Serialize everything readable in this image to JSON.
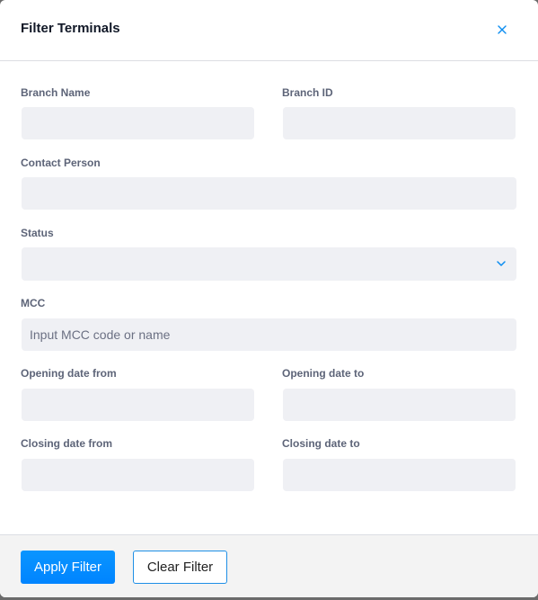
{
  "dialog": {
    "title": "Filter Terminals",
    "close_icon": "close-icon",
    "accent_color": "#0a8cf0"
  },
  "fields": {
    "branch_name": {
      "label": "Branch Name",
      "value": "",
      "placeholder": ""
    },
    "branch_id": {
      "label": "Branch ID",
      "value": "",
      "placeholder": ""
    },
    "contact_person": {
      "label": "Contact Person",
      "value": "",
      "placeholder": ""
    },
    "status": {
      "label": "Status",
      "selected": "",
      "icon": "chevron-down-icon"
    },
    "mcc": {
      "label": "MCC",
      "value": "",
      "placeholder": "Input MCC code or name"
    },
    "opening_date_from": {
      "label": "Opening date from",
      "value": ""
    },
    "opening_date_to": {
      "label": "Opening date to",
      "value": ""
    },
    "closing_date_from": {
      "label": "Closing date from",
      "value": ""
    },
    "closing_date_to": {
      "label": "Closing date to",
      "value": ""
    }
  },
  "footer": {
    "apply_label": "Apply Filter",
    "clear_label": "Clear Filter"
  }
}
